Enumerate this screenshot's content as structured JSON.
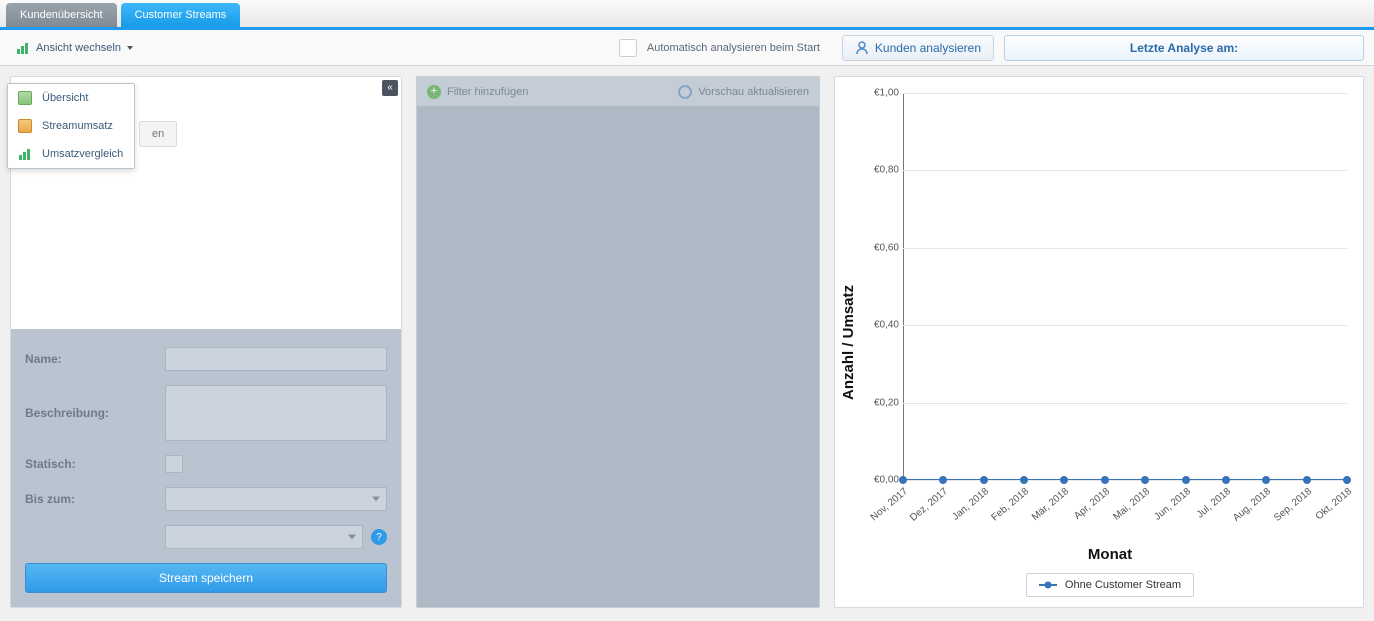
{
  "tabs": {
    "inactive": "Kundenübersicht",
    "active": "Customer Streams"
  },
  "toolbar": {
    "view_switch": "Ansicht wechseln",
    "auto_analyze": "Automatisch analysieren beim Start",
    "analyze": "Kunden analysieren",
    "last_analysis": "Letzte Analyse am:"
  },
  "dropdown": {
    "item0": "Übersicht",
    "item1": "Streamumsatz",
    "item2": "Umsatzvergleich"
  },
  "left": {
    "peek": "en",
    "name_label": "Name:",
    "desc_label": "Beschreibung:",
    "static_label": "Statisch:",
    "until_label": "Bis zum:",
    "save": "Stream speichern"
  },
  "mid": {
    "add_filter": "Filter hinzufügen",
    "refresh_preview": "Vorschau aktualisieren"
  },
  "chart": {
    "ylabel": "Anzahl / Umsatz",
    "xlabel": "Monat",
    "legend": "Ohne Customer Stream"
  },
  "chart_data": {
    "type": "line",
    "title": "",
    "xlabel": "Monat",
    "ylabel": "Anzahl / Umsatz",
    "ylim": [
      0,
      1
    ],
    "y_prefix": "€",
    "y_ticks": [
      "€0,00",
      "€0,20",
      "€0,40",
      "€0,60",
      "€0,80",
      "€1,00"
    ],
    "categories": [
      "Nov, 2017",
      "Dez, 2017",
      "Jan, 2018",
      "Feb, 2018",
      "Mär, 2018",
      "Apr, 2018",
      "Mai, 2018",
      "Jun, 2018",
      "Jul, 2018",
      "Aug, 2018",
      "Sep, 2018",
      "Okt, 2018"
    ],
    "series": [
      {
        "name": "Ohne Customer Stream",
        "values": [
          0,
          0,
          0,
          0,
          0,
          0,
          0,
          0,
          0,
          0,
          0,
          0
        ]
      }
    ]
  }
}
